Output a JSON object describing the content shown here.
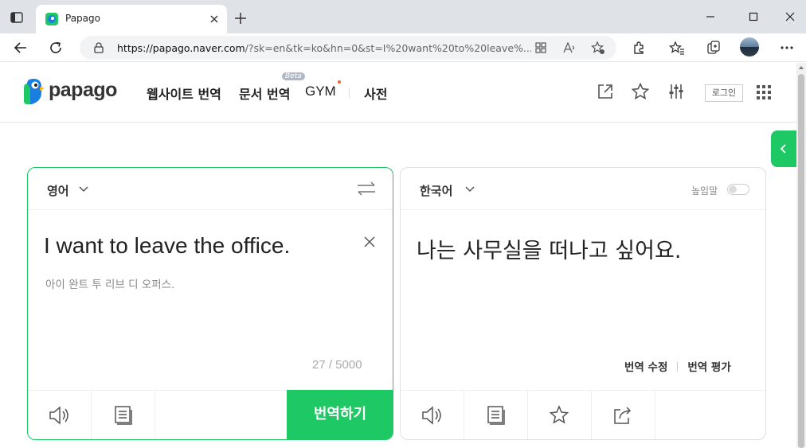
{
  "browser": {
    "tab_title": "Papago",
    "url_host": "https://papago.naver.com",
    "url_rest": "/?sk=en&tk=ko&hn=0&st=I%20want%20to%20leave%..."
  },
  "header": {
    "logo_text": "papago",
    "nav": {
      "website": "웹사이트 번역",
      "document": "문서 번역",
      "beta": "Beta",
      "gym": "GYM",
      "dictionary": "사전"
    },
    "login": "로그인"
  },
  "source": {
    "language": "영어",
    "text": "I want to leave the office.",
    "pronunciation": "아이 완트 투 리브 디 오퍼스.",
    "count": "27 / 5000",
    "translate_button": "번역하기"
  },
  "target": {
    "language": "한국어",
    "honorific_label": "높임말",
    "honorific_on": false,
    "text": "나는 사무실을 떠나고 싶어요.",
    "edit_label": "번역 수정",
    "rate_label": "번역 평가"
  },
  "colors": {
    "brand_green": "#1ec864",
    "badge_dot": "#ff5a36"
  }
}
